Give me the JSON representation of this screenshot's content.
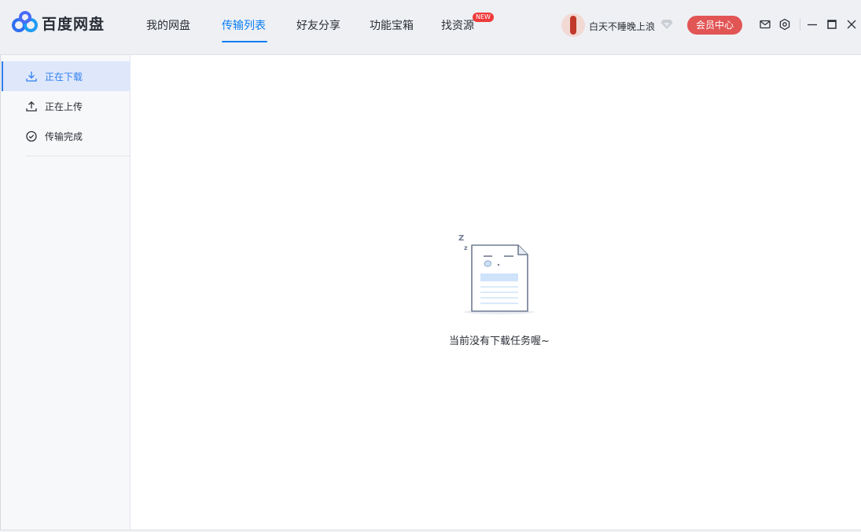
{
  "app": {
    "title": "百度网盘",
    "brand_color": "#0a7ef5"
  },
  "nav": {
    "items": [
      {
        "label": "我的网盘",
        "active": false
      },
      {
        "label": "传输列表",
        "active": true
      },
      {
        "label": "好友分享",
        "active": false
      },
      {
        "label": "功能宝箱",
        "active": false
      },
      {
        "label": "找资源",
        "active": false,
        "badge": "NEW"
      }
    ]
  },
  "user": {
    "name": "白天不睡晚上浪",
    "vip_icon": "diamond-icon",
    "member_button": "会员中心",
    "member_color": "#e25555"
  },
  "toolbar": {
    "icons": [
      "mail-icon",
      "settings-icon",
      "minimize-icon",
      "maximize-icon",
      "close-icon"
    ]
  },
  "sidebar": {
    "items": [
      {
        "label": "正在下载",
        "icon": "download-icon",
        "active": true
      },
      {
        "label": "正在上传",
        "icon": "upload-icon",
        "active": false
      },
      {
        "label": "传输完成",
        "icon": "check-circle-icon",
        "active": false
      }
    ]
  },
  "main": {
    "empty_icon": "sleeping-document-icon",
    "empty_text": "当前没有下载任务喔~"
  }
}
